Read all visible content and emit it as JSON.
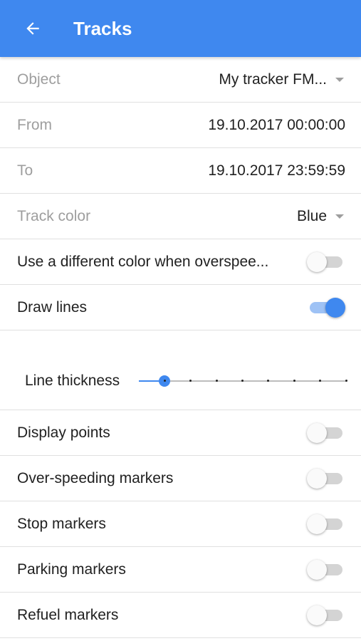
{
  "appbar": {
    "title": "Tracks",
    "back_icon": "arrow-left-icon",
    "background": "#3f88ef"
  },
  "form": {
    "object": {
      "label": "Object",
      "value": "My tracker FM..."
    },
    "from": {
      "label": "From",
      "value": "19.10.2017 00:00:00"
    },
    "to": {
      "label": "To",
      "value": "19.10.2017 23:59:59"
    },
    "track_color": {
      "label": "Track color",
      "value": "Blue"
    },
    "overspeed_color": {
      "label": "Use a different color when overspee...",
      "checked": false
    },
    "draw_lines": {
      "label": "Draw lines",
      "checked": true
    },
    "line_thickness": {
      "label": "Line thickness",
      "step": 1,
      "max": 9
    },
    "display_points": {
      "label": "Display points",
      "checked": false
    },
    "overspeeding_markers": {
      "label": "Over-speeding markers",
      "checked": false
    },
    "stop_markers": {
      "label": "Stop markers",
      "checked": false
    },
    "parking_markers": {
      "label": "Parking markers",
      "checked": false
    },
    "refuel_markers": {
      "label": "Refuel markers",
      "checked": false
    }
  },
  "colors": {
    "accent": "#3f88ef",
    "muted_text": "#9e9e9e",
    "divider": "#e0e0e0"
  }
}
